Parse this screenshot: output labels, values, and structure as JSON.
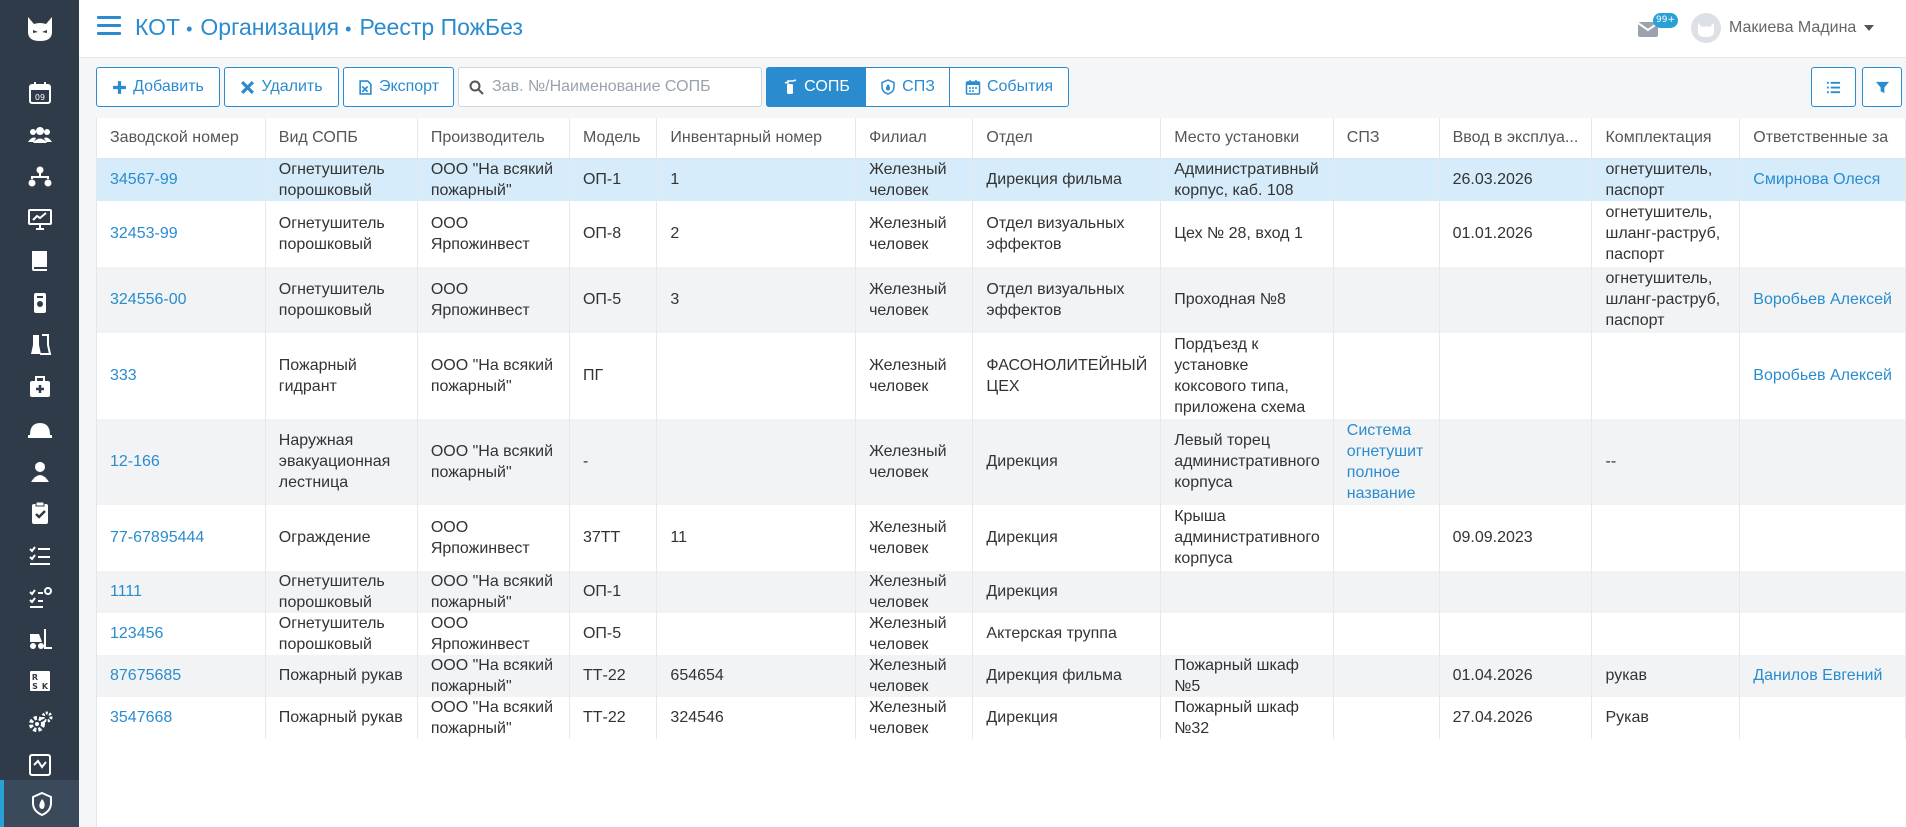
{
  "header": {
    "breadcrumbs": [
      "КОТ",
      "Организация",
      "Реестр ПожБез"
    ],
    "separator": "•",
    "mail_badge": "99+",
    "user_name": "Макиева Мадина"
  },
  "toolbar": {
    "add_label": "Добавить",
    "delete_label": "Удалить",
    "export_label": "Экспорт",
    "search_placeholder": "Зав. №/Наименование СОПБ",
    "tabs": [
      {
        "label": "СОПБ",
        "active": true,
        "icon": "fire-extinguisher-icon"
      },
      {
        "label": "СПЗ",
        "active": false,
        "icon": "shield-fire-icon"
      },
      {
        "label": "События",
        "active": false,
        "icon": "calendar-icon"
      }
    ]
  },
  "table": {
    "columns": [
      "Заводской номер",
      "Вид СОПБ",
      "Производитель",
      "Модель",
      "Инвентарный номер",
      "Филиал",
      "Отдел",
      "Место установки",
      "СПЗ",
      "Ввод в эксплуа...",
      "Комплектация",
      "Ответственные за"
    ],
    "rows": [
      [
        "34567-99",
        "Огнетушитель порошковый",
        "ООО \"На всякий пожарный\"",
        "ОП-1",
        "1",
        "Железный человек",
        "Дирекция фильма",
        "Административный корпус, каб. 108",
        "",
        "26.03.2026",
        "огнетушитель, паспорт",
        "Смирнова Олеся"
      ],
      [
        "32453-99",
        "Огнетушитель порошковый",
        "ООО Ярпожинвест",
        "ОП-8",
        "2",
        "Железный человек",
        "Отдел визуальных эффектов",
        "Цех № 28, вход 1",
        "",
        "01.01.2026",
        "огнетушитель, шланг-раструб, паспорт",
        ""
      ],
      [
        "324556-00",
        "Огнетушитель порошковый",
        "ООО Ярпожинвест",
        "ОП-5",
        "3",
        "Железный человек",
        "Отдел визуальных эффектов",
        "Проходная №8",
        "",
        "",
        "огнетушитель, шланг-раструб, паспорт",
        "Воробьев Алексей"
      ],
      [
        "333",
        "Пожарный гидрант",
        "ООО \"На всякий пожарный\"",
        "ПГ",
        "",
        "Железный человек",
        "ФАСОНОЛИТЕЙНЫЙ ЦЕХ",
        "Пордъезд к установке коксового типа, приложена схема",
        "",
        "",
        "",
        "Воробьев Алексей"
      ],
      [
        "12-166",
        "Наружная эвакуационная лестница",
        "ООО \"На всякий пожарный\"",
        "-",
        "",
        "Железный человек",
        "Дирекция",
        "Левый торец административного корпуса",
        "Система огнетушит полное название",
        "",
        "--",
        ""
      ],
      [
        "77-67895444",
        "Ограждение",
        "ООО Ярпожинвест",
        "37ТТ",
        "11",
        "Железный человек",
        "Дирекция",
        "Крыша административного корпуса",
        "",
        "09.09.2023",
        "",
        ""
      ],
      [
        "1111",
        "Огнетушитель порошковый",
        "ООО \"На всякий пожарный\"",
        "ОП-1",
        "",
        "Железный человек",
        "Дирекция",
        "",
        "",
        "",
        "",
        ""
      ],
      [
        "123456",
        "Огнетушитель порошковый",
        "ООО Ярпожинвест",
        "ОП-5",
        "",
        "Железный человек",
        "Актерская труппа",
        "",
        "",
        "",
        "",
        ""
      ],
      [
        "87675685",
        "Пожарный рукав",
        "ООО \"На всякий пожарный\"",
        "ТТ-22",
        "654654",
        "Железный человек",
        "Дирекция фильма",
        "Пожарный шкаф №5",
        "",
        "01.04.2026",
        "рукав",
        "Данилов Евгений"
      ],
      [
        "3547668",
        "Пожарный рукав",
        "ООО \"На всякий пожарный\"",
        "ТТ-22",
        "324546",
        "Железный человек",
        "Дирекция",
        "Пожарный шкаф №32",
        "",
        "27.04.2026",
        "Рукав",
        ""
      ]
    ]
  },
  "colors": {
    "accent": "#2a8ccf",
    "sidebar": "#2f3b48",
    "selected_row": "#d6ecfa",
    "striped_row": "#f2f3f5"
  }
}
